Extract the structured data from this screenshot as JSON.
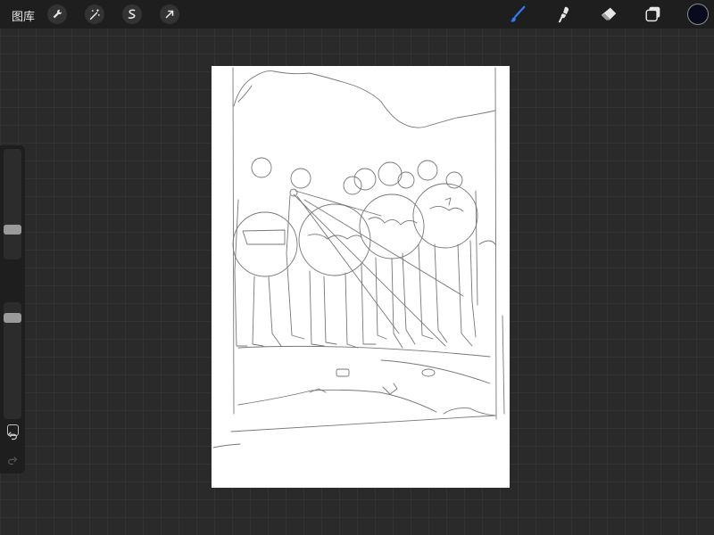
{
  "toolbar": {
    "gallery_label": "图库",
    "left_tools": [
      "wrench-icon",
      "magic-wand-icon",
      "selection-icon",
      "transform-arrow-icon"
    ],
    "right_tools": [
      "brush-icon",
      "smudge-icon",
      "eraser-icon",
      "layers-icon"
    ],
    "active_tool": "brush-icon",
    "active_color": "#0a0a1e",
    "accent": "#2f7cf6"
  },
  "sidebar": {
    "brush_size_level": 0.25,
    "opacity_level": 0.9
  }
}
